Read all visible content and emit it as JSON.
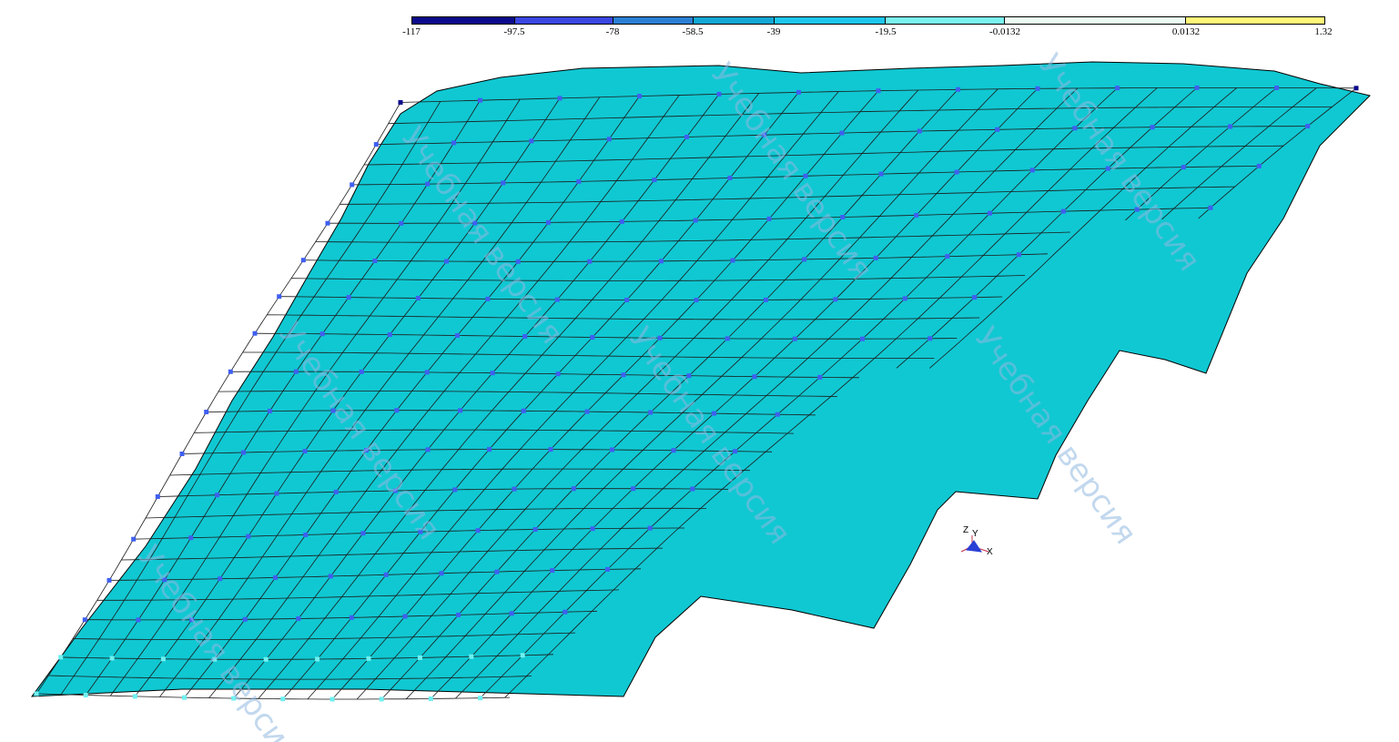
{
  "legend": {
    "ticks": [
      "-117",
      "-97.5",
      "-78",
      "-58.5",
      "-39",
      "-19.5",
      "-0.0132",
      "0.0132",
      "1.32"
    ],
    "colors": [
      "#0a0a8c",
      "#3a46e0",
      "#2b7fd3",
      "#12a7d4",
      "#1ec6ee",
      "#7af2f0",
      "#eafcf4",
      "#fff67a"
    ]
  },
  "surface": {
    "fill_color": "#10c8d2",
    "grid_color": "#1a1a1a",
    "node_color": "#3f5ff0"
  },
  "watermark": {
    "text": "Учебная версия",
    "color": "#8fb8e0"
  },
  "axis_triad": {
    "labels": [
      "Z",
      "Y",
      "X"
    ]
  }
}
